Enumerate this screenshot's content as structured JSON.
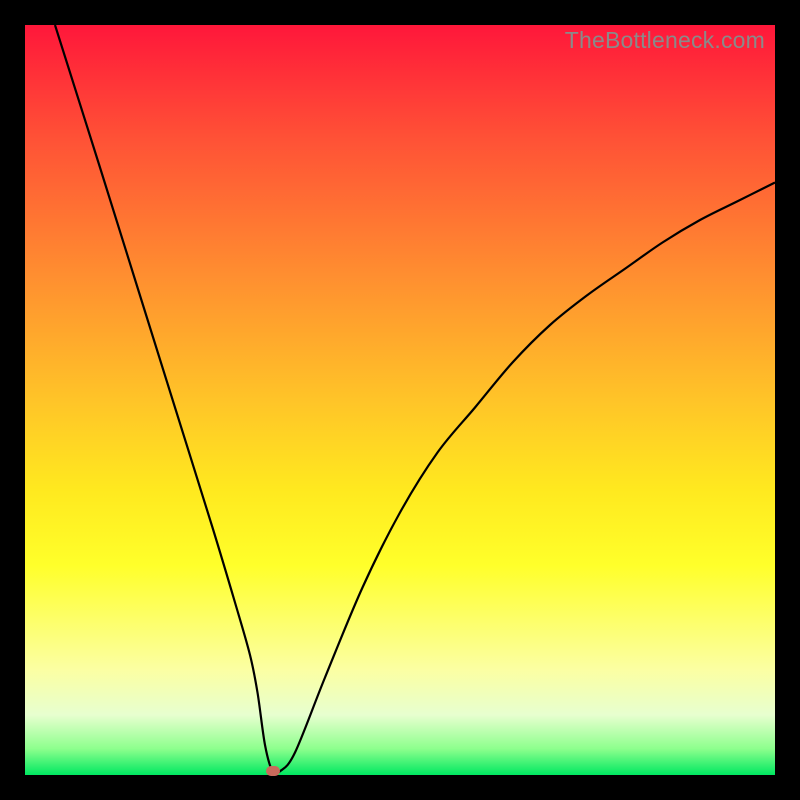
{
  "watermark": "TheBottleneck.com",
  "chart_data": {
    "type": "line",
    "title": "",
    "xlabel": "",
    "ylabel": "",
    "xlim": [
      0,
      100
    ],
    "ylim": [
      0,
      100
    ],
    "grid": false,
    "series": [
      {
        "name": "curve",
        "x": [
          4,
          10,
          15,
          20,
          25,
          28,
          30,
          31,
          32,
          33,
          34,
          36,
          40,
          45,
          50,
          55,
          60,
          65,
          70,
          75,
          80,
          85,
          90,
          95,
          100
        ],
        "y": [
          100,
          81,
          65,
          49,
          33,
          23,
          16,
          11,
          4,
          0.5,
          0.5,
          3,
          13,
          25,
          35,
          43,
          49,
          55,
          60,
          64,
          67.5,
          71,
          74,
          76.5,
          79
        ]
      }
    ],
    "marker": {
      "x": 33,
      "y": 0.5
    },
    "gradient_stops": [
      {
        "pos": 0,
        "color": "#ff173a"
      },
      {
        "pos": 15,
        "color": "#ff5136"
      },
      {
        "pos": 33,
        "color": "#ff8d30"
      },
      {
        "pos": 50,
        "color": "#ffc428"
      },
      {
        "pos": 62,
        "color": "#ffe91f"
      },
      {
        "pos": 72,
        "color": "#ffff2a"
      },
      {
        "pos": 86,
        "color": "#fbffa3"
      },
      {
        "pos": 92,
        "color": "#e7ffcf"
      },
      {
        "pos": 96.5,
        "color": "#8dff8d"
      },
      {
        "pos": 100,
        "color": "#00e861"
      }
    ]
  }
}
